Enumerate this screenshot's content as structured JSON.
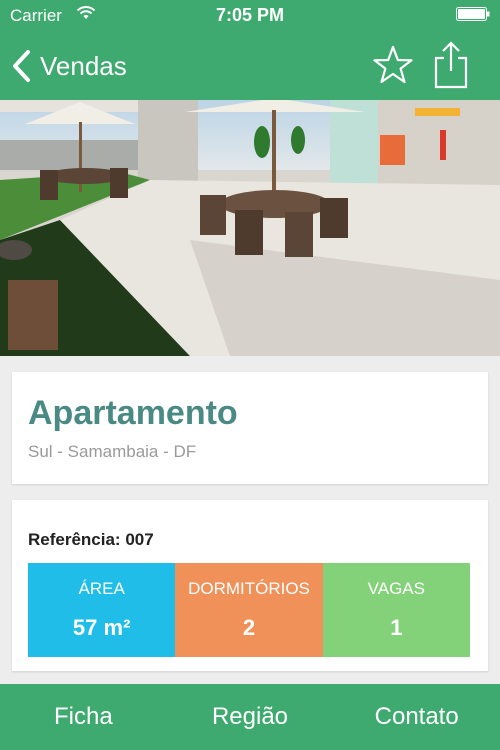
{
  "status_bar": {
    "carrier": "Carrier",
    "time": "7:05 PM"
  },
  "nav": {
    "back_label": "Vendas"
  },
  "property": {
    "title": "Apartamento",
    "location": "Sul - Samambaia - DF",
    "reference_label": "Referência:",
    "reference_value": "007"
  },
  "stats": [
    {
      "label": "ÁREA",
      "value": "57 m²",
      "color": "#1fbde8"
    },
    {
      "label": "DORMITÓRIOS",
      "value": "2",
      "color": "#f0915a"
    },
    {
      "label": "VAGAS",
      "value": "1",
      "color": "#83d27a"
    }
  ],
  "tabs": [
    {
      "label": "Ficha"
    },
    {
      "label": "Região"
    },
    {
      "label": "Contato"
    }
  ],
  "colors": {
    "brand_green": "#3eaa6f",
    "title_teal": "#4a8a85"
  }
}
